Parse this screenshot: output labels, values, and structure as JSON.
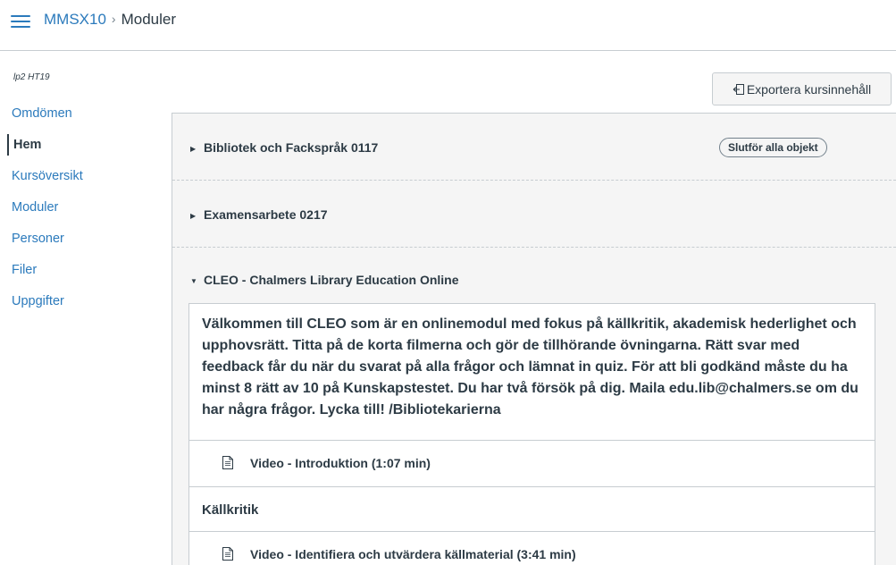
{
  "header": {
    "menu_icon": "hamburger-icon",
    "course": "MMSX10",
    "separator": "›",
    "current": "Moduler",
    "accent": "#2b7abc"
  },
  "sidebar": {
    "term": "lp2 HT19",
    "items": [
      {
        "label": "Omdömen",
        "active": false
      },
      {
        "label": "Hem",
        "active": true
      },
      {
        "label": "Kursöversikt",
        "active": false
      },
      {
        "label": "Moduler",
        "active": false
      },
      {
        "label": "Personer",
        "active": false
      },
      {
        "label": "Filer",
        "active": false
      },
      {
        "label": "Uppgifter",
        "active": false
      }
    ]
  },
  "toolbar": {
    "export_label": "Exportera kursinnehåll",
    "export_icon": "export-icon"
  },
  "modules": [
    {
      "title": "Bibliotek och Fackspråk 0117",
      "collapsed": true,
      "requirement": "Slutför alla objekt"
    },
    {
      "title": "Examensarbete 0217",
      "collapsed": true
    },
    {
      "title": "CLEO - Chalmers Library Education Online",
      "collapsed": false,
      "intro": "Välkommen till CLEO som är en onlinemodul med fokus på källkritik, akademisk hederlighet och upphovsrätt. Titta på de korta filmerna och gör de tillhörande övningarna. Rätt svar med feedback får du när du svarat på alla frågor och lämnat in quiz. För att bli godkänd måste du ha minst 8 rätt av 10 på Kunskapstestet. Du har två försök på dig. Maila edu.lib@chalmers.se om du har några frågor. Lycka till! /Bibliotekarierna",
      "items": [
        {
          "label": "Video - Introduktion (1:07 min)",
          "icon": "document-icon"
        },
        {
          "subheader": "Källkritik"
        },
        {
          "label": "Video - Identifiera och utvärdera källmaterial (3:41 min)",
          "icon": "document-icon"
        }
      ]
    }
  ]
}
